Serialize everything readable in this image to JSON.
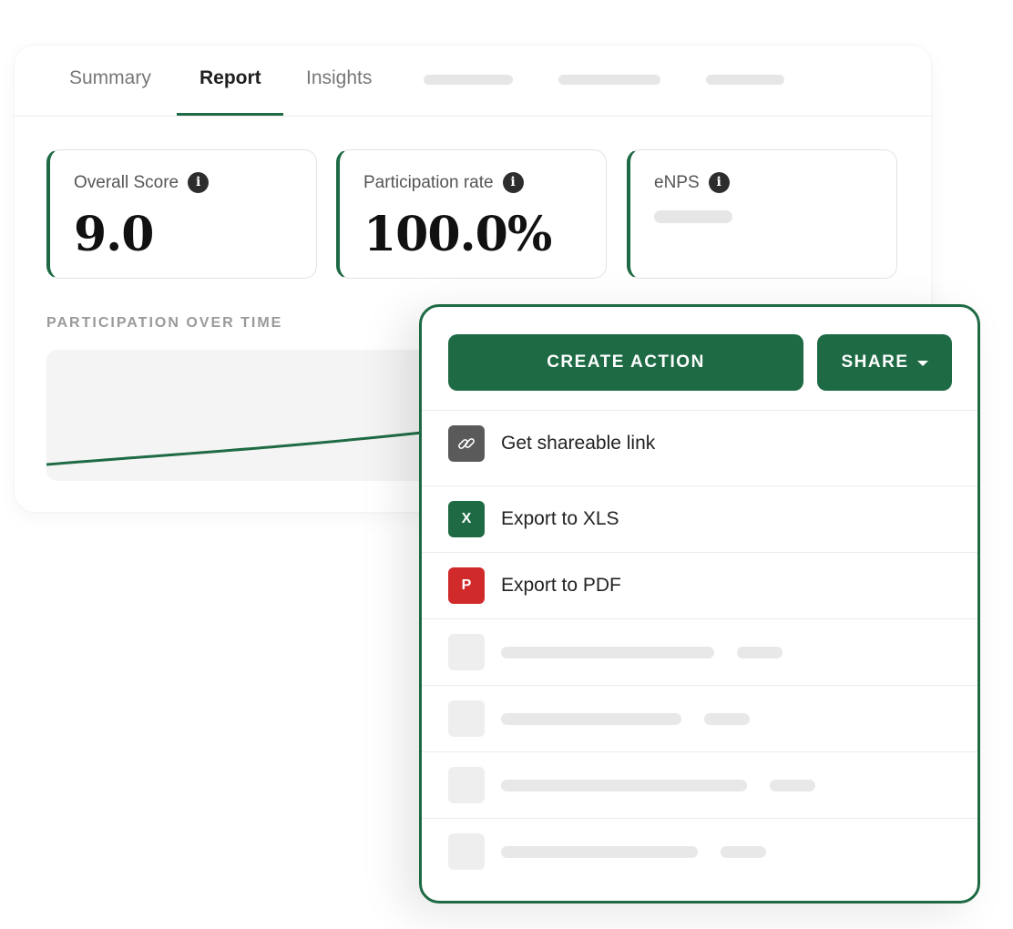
{
  "tabs": [
    {
      "label": "Summary",
      "active": false
    },
    {
      "label": "Report",
      "active": true
    },
    {
      "label": "Insights",
      "active": false
    }
  ],
  "stats": {
    "overall_score": {
      "label": "Overall Score",
      "value": "9.0"
    },
    "participation_rate": {
      "label": "Participation rate",
      "value": "100.0%"
    },
    "enps": {
      "label": "eNPS"
    }
  },
  "info_icon_glyph": "i",
  "section_title": "PARTICIPATION OVER TIME",
  "share_panel": {
    "create_action_label": "CREATE ACTION",
    "share_label": "SHARE",
    "menu": [
      {
        "label": "Get shareable link",
        "icon": "link-icon"
      },
      {
        "label": "Export to XLS",
        "icon": "xls-icon",
        "glyph": "X"
      },
      {
        "label": "Export to PDF",
        "icon": "pdf-icon",
        "glyph": "P"
      }
    ]
  },
  "colors": {
    "accent": "#1e6a44",
    "pdf": "#d12a2a",
    "link_icon_bg": "#5a5a5a"
  }
}
